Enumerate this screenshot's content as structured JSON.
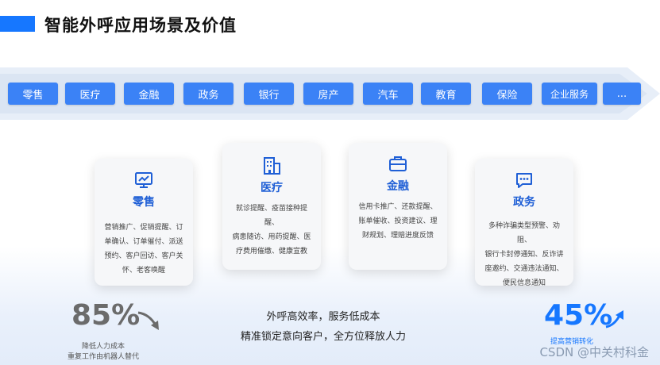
{
  "page": {
    "title": "智能外呼应用场景及价值"
  },
  "tags": [
    "零售",
    "医疗",
    "金融",
    "政务",
    "银行",
    "房产",
    "汽车",
    "教育",
    "保险",
    "企业服务",
    "..."
  ],
  "cards": [
    {
      "title": "零售",
      "icon": "chart-monitor-icon",
      "desc": [
        "营销推广、促销提醒、订",
        "单确认、订单催付、派送",
        "预约、客户回访、客户关",
        "怀、老客唤醒"
      ]
    },
    {
      "title": "医疗",
      "icon": "hospital-building-icon",
      "desc": [
        "就诊提醒、疫苗接种提醒、",
        "病患随访、用药提醒、医",
        "疗费用催缴、健康宣教"
      ]
    },
    {
      "title": "金融",
      "icon": "briefcase-icon",
      "desc": [
        "信用卡推广、还款提醒、",
        "账单催收、投资建议、理",
        "财规划、理赔进度反馈"
      ]
    },
    {
      "title": "政务",
      "icon": "chat-bubble-icon",
      "desc": [
        "多种诈骗类型预警、劝阻、",
        "银行卡封停通知、反诈讲",
        "座邀约、交通违法通知、",
        "便民信息通知"
      ]
    }
  ],
  "stats": {
    "left": {
      "value": "85%",
      "caption": [
        "降低人力成本",
        "重复工作由机器人替代"
      ],
      "color": "#6b6b6b"
    },
    "right": {
      "value": "45%",
      "caption": [
        "提高营销转化"
      ],
      "color": "#1677ff"
    }
  },
  "center": {
    "line1": "外呼高效率，服务低成本",
    "line2": "精准锁定意向客户，全方位释放人力"
  },
  "watermark": "CSDN @中关村科金"
}
